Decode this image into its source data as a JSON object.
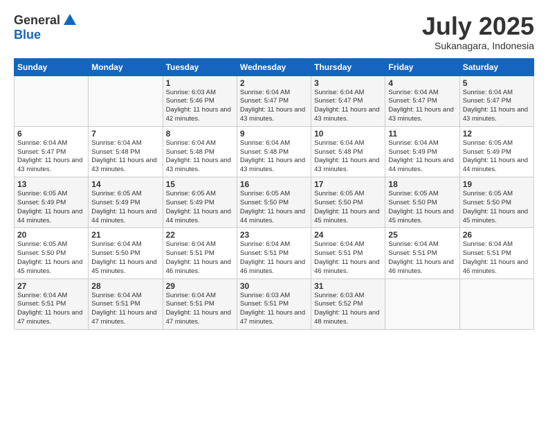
{
  "header": {
    "logo_general": "General",
    "logo_blue": "Blue",
    "month_title": "July 2025",
    "subtitle": "Sukanagara, Indonesia"
  },
  "calendar": {
    "days_of_week": [
      "Sunday",
      "Monday",
      "Tuesday",
      "Wednesday",
      "Thursday",
      "Friday",
      "Saturday"
    ],
    "weeks": [
      [
        {
          "day": "",
          "info": ""
        },
        {
          "day": "",
          "info": ""
        },
        {
          "day": "1",
          "info": "Sunrise: 6:03 AM\nSunset: 5:46 PM\nDaylight: 11 hours and 42 minutes."
        },
        {
          "day": "2",
          "info": "Sunrise: 6:04 AM\nSunset: 5:47 PM\nDaylight: 11 hours and 43 minutes."
        },
        {
          "day": "3",
          "info": "Sunrise: 6:04 AM\nSunset: 5:47 PM\nDaylight: 11 hours and 43 minutes."
        },
        {
          "day": "4",
          "info": "Sunrise: 6:04 AM\nSunset: 5:47 PM\nDaylight: 11 hours and 43 minutes."
        },
        {
          "day": "5",
          "info": "Sunrise: 6:04 AM\nSunset: 5:47 PM\nDaylight: 11 hours and 43 minutes."
        }
      ],
      [
        {
          "day": "6",
          "info": "Sunrise: 6:04 AM\nSunset: 5:47 PM\nDaylight: 11 hours and 43 minutes."
        },
        {
          "day": "7",
          "info": "Sunrise: 6:04 AM\nSunset: 5:48 PM\nDaylight: 11 hours and 43 minutes."
        },
        {
          "day": "8",
          "info": "Sunrise: 6:04 AM\nSunset: 5:48 PM\nDaylight: 11 hours and 43 minutes."
        },
        {
          "day": "9",
          "info": "Sunrise: 6:04 AM\nSunset: 5:48 PM\nDaylight: 11 hours and 43 minutes."
        },
        {
          "day": "10",
          "info": "Sunrise: 6:04 AM\nSunset: 5:48 PM\nDaylight: 11 hours and 43 minutes."
        },
        {
          "day": "11",
          "info": "Sunrise: 6:04 AM\nSunset: 5:49 PM\nDaylight: 11 hours and 44 minutes."
        },
        {
          "day": "12",
          "info": "Sunrise: 6:05 AM\nSunset: 5:49 PM\nDaylight: 11 hours and 44 minutes."
        }
      ],
      [
        {
          "day": "13",
          "info": "Sunrise: 6:05 AM\nSunset: 5:49 PM\nDaylight: 11 hours and 44 minutes."
        },
        {
          "day": "14",
          "info": "Sunrise: 6:05 AM\nSunset: 5:49 PM\nDaylight: 11 hours and 44 minutes."
        },
        {
          "day": "15",
          "info": "Sunrise: 6:05 AM\nSunset: 5:49 PM\nDaylight: 11 hours and 44 minutes."
        },
        {
          "day": "16",
          "info": "Sunrise: 6:05 AM\nSunset: 5:50 PM\nDaylight: 11 hours and 44 minutes."
        },
        {
          "day": "17",
          "info": "Sunrise: 6:05 AM\nSunset: 5:50 PM\nDaylight: 11 hours and 45 minutes."
        },
        {
          "day": "18",
          "info": "Sunrise: 6:05 AM\nSunset: 5:50 PM\nDaylight: 11 hours and 45 minutes."
        },
        {
          "day": "19",
          "info": "Sunrise: 6:05 AM\nSunset: 5:50 PM\nDaylight: 11 hours and 45 minutes."
        }
      ],
      [
        {
          "day": "20",
          "info": "Sunrise: 6:05 AM\nSunset: 5:50 PM\nDaylight: 11 hours and 45 minutes."
        },
        {
          "day": "21",
          "info": "Sunrise: 6:04 AM\nSunset: 5:50 PM\nDaylight: 11 hours and 45 minutes."
        },
        {
          "day": "22",
          "info": "Sunrise: 6:04 AM\nSunset: 5:51 PM\nDaylight: 11 hours and 46 minutes."
        },
        {
          "day": "23",
          "info": "Sunrise: 6:04 AM\nSunset: 5:51 PM\nDaylight: 11 hours and 46 minutes."
        },
        {
          "day": "24",
          "info": "Sunrise: 6:04 AM\nSunset: 5:51 PM\nDaylight: 11 hours and 46 minutes."
        },
        {
          "day": "25",
          "info": "Sunrise: 6:04 AM\nSunset: 5:51 PM\nDaylight: 11 hours and 46 minutes."
        },
        {
          "day": "26",
          "info": "Sunrise: 6:04 AM\nSunset: 5:51 PM\nDaylight: 11 hours and 46 minutes."
        }
      ],
      [
        {
          "day": "27",
          "info": "Sunrise: 6:04 AM\nSunset: 5:51 PM\nDaylight: 11 hours and 47 minutes."
        },
        {
          "day": "28",
          "info": "Sunrise: 6:04 AM\nSunset: 5:51 PM\nDaylight: 11 hours and 47 minutes."
        },
        {
          "day": "29",
          "info": "Sunrise: 6:04 AM\nSunset: 5:51 PM\nDaylight: 11 hours and 47 minutes."
        },
        {
          "day": "30",
          "info": "Sunrise: 6:03 AM\nSunset: 5:51 PM\nDaylight: 11 hours and 47 minutes."
        },
        {
          "day": "31",
          "info": "Sunrise: 6:03 AM\nSunset: 5:52 PM\nDaylight: 11 hours and 48 minutes."
        },
        {
          "day": "",
          "info": ""
        },
        {
          "day": "",
          "info": ""
        }
      ]
    ]
  }
}
